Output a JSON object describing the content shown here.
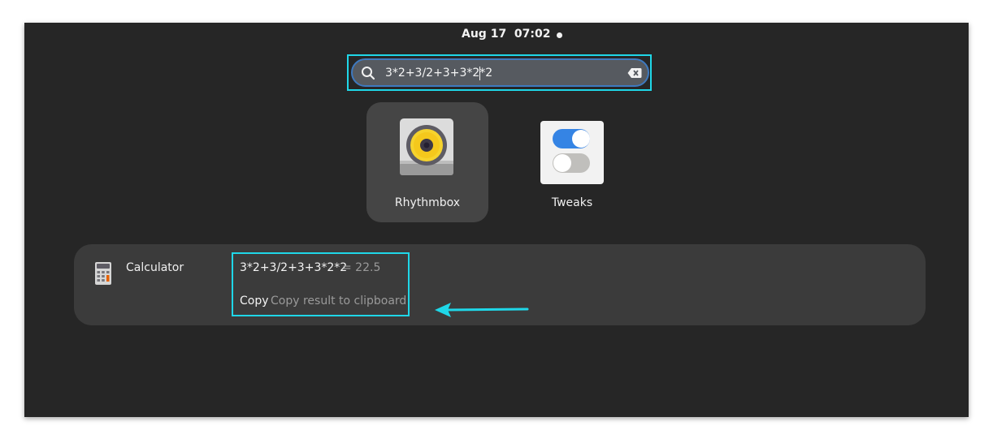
{
  "topbar": {
    "clock": "Aug 17  07:02"
  },
  "search": {
    "value": "3*2+3/2+3+3*2*2",
    "icon": "search-icon",
    "clear_icon": "clear-text-icon"
  },
  "apps": [
    {
      "label": "Rhythmbox",
      "icon": "rhythmbox-speaker-icon",
      "selected": true
    },
    {
      "label": "Tweaks",
      "icon": "tweaks-toggle-icon",
      "selected": false
    }
  ],
  "calculator": {
    "provider": "Calculator",
    "expression": "3*2+3/2+3+3*2*2",
    "result": "= 22.5",
    "copy_label": "Copy",
    "copy_description": "Copy result to clipboard"
  },
  "colors": {
    "background": "#262626",
    "highlight": "#1fd7e8",
    "focus_ring": "#3e79bf",
    "accent_blue": "#3584e4",
    "speaker_yellow": "#f6d32d"
  }
}
